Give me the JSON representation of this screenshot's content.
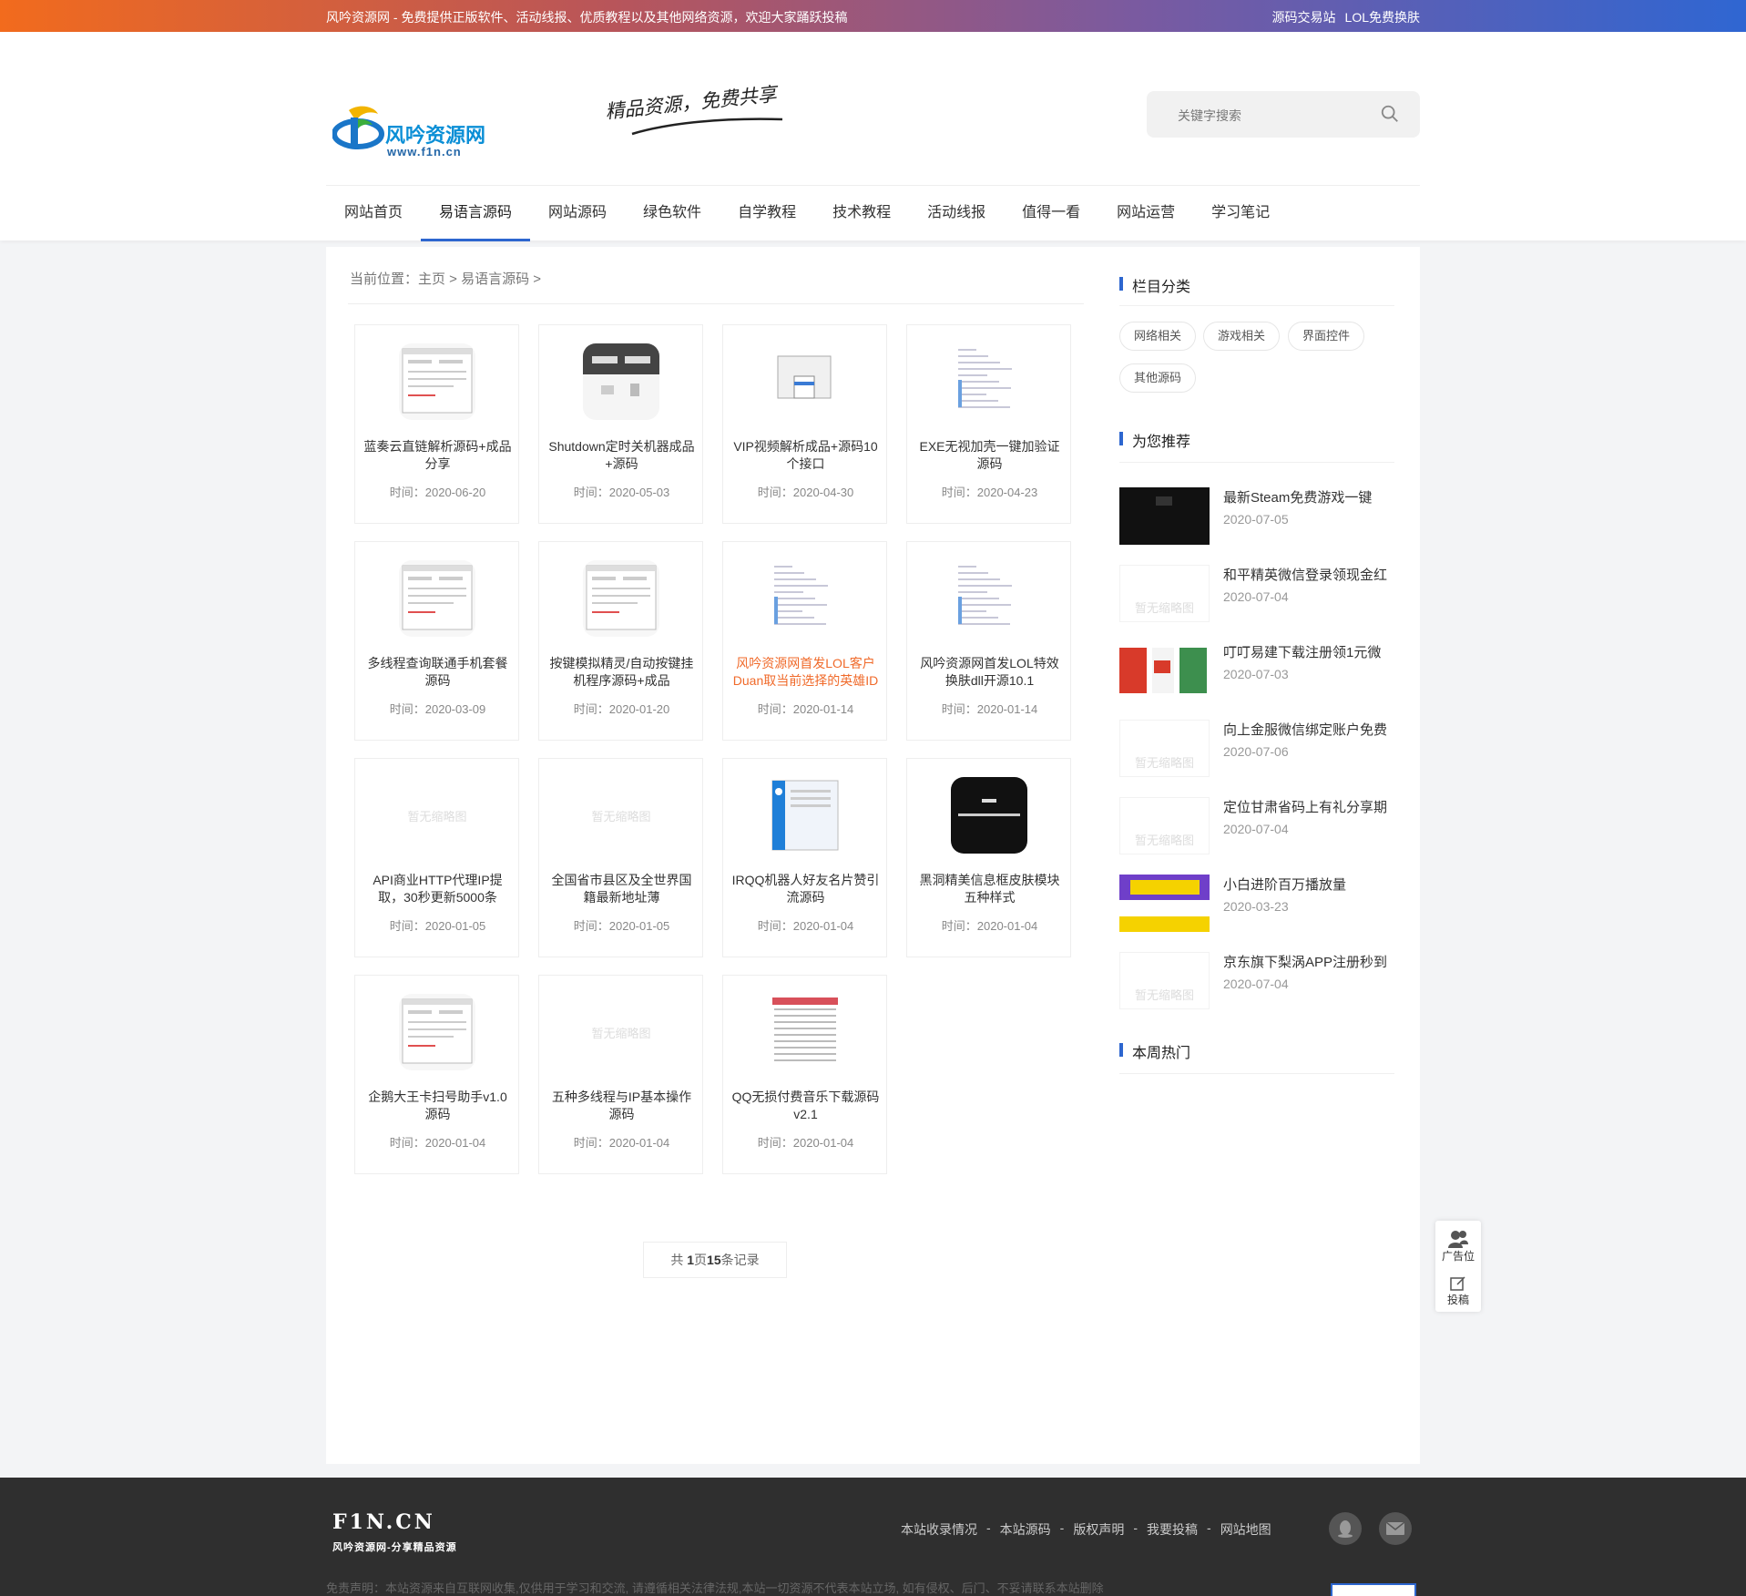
{
  "topbar": {
    "message": "风吟资源网 - 免费提供正版软件、活动线报、优质教程以及其他网络资源，欢迎大家踊跃投稿",
    "links": [
      "源码交易站",
      "LOL免费换肤"
    ]
  },
  "header": {
    "logo_text": "风吟资源网",
    "logo_url": "www.f1n.cn",
    "slogan": "精品资源，免费共享",
    "search_placeholder": "关键字搜索"
  },
  "nav": [
    {
      "label": "网站首页",
      "active": false
    },
    {
      "label": "易语言源码",
      "active": true
    },
    {
      "label": "网站源码",
      "active": false
    },
    {
      "label": "绿色软件",
      "active": false
    },
    {
      "label": "自学教程",
      "active": false
    },
    {
      "label": "技术教程",
      "active": false
    },
    {
      "label": "活动线报",
      "active": false
    },
    {
      "label": "值得一看",
      "active": false
    },
    {
      "label": "网站运营",
      "active": false
    },
    {
      "label": "学习笔记",
      "active": false
    }
  ],
  "breadcrumb": "当前位置：主页 > 易语言源码 >",
  "no_thumb_text": "暂无缩略图",
  "cards": [
    {
      "title": "蓝奏云直链解析源码+成品分享",
      "date": "时间：2020-06-20",
      "thumb": "window",
      "highlight": false
    },
    {
      "title": "Shutdown定时关机器成品+源码",
      "date": "时间：2020-05-03",
      "thumb": "dark-window",
      "highlight": false
    },
    {
      "title": "VIP视频解析成品+源码10个接口",
      "date": "时间：2020-04-30",
      "thumb": "dialog",
      "highlight": false
    },
    {
      "title": "EXE无视加壳一键加验证源码",
      "date": "时间：2020-04-23",
      "thumb": "code",
      "highlight": false
    },
    {
      "title": "多线程查询联通手机套餐源码",
      "date": "时间：2020-03-09",
      "thumb": "window",
      "highlight": false
    },
    {
      "title": "按键模拟精灵/自动按键挂机程序源码+成品",
      "date": "时间：2020-01-20",
      "thumb": "window",
      "highlight": false
    },
    {
      "title": "风吟资源网首发LOL客户Duan取当前选择的英雄ID",
      "date": "时间：2020-01-14",
      "thumb": "code",
      "highlight": true
    },
    {
      "title": "风吟资源网首发LOL特效换肤dll开源10.1",
      "date": "时间：2020-01-14",
      "thumb": "code",
      "highlight": false
    },
    {
      "title": "API商业HTTP代理IP提取，30秒更新5000条",
      "date": "时间：2020-01-05",
      "thumb": "none",
      "highlight": false
    },
    {
      "title": "全国省市县区及全世界国籍最新地址薄",
      "date": "时间：2020-01-05",
      "thumb": "none",
      "highlight": false
    },
    {
      "title": "IRQQ机器人好友名片赞引流源码",
      "date": "时间：2020-01-04",
      "thumb": "blue-window",
      "highlight": false
    },
    {
      "title": "黑洞精美信息框皮肤模块五种样式",
      "date": "时间：2020-01-04",
      "thumb": "black",
      "highlight": false
    },
    {
      "title": "企鹅大王卡扫号助手v1.0源码",
      "date": "时间：2020-01-04",
      "thumb": "window",
      "highlight": false
    },
    {
      "title": "五种多线程与IP基本操作源码",
      "date": "时间：2020-01-04",
      "thumb": "none",
      "highlight": false
    },
    {
      "title": "QQ无损付费音乐下载源码v2.1",
      "date": "时间：2020-01-04",
      "thumb": "table",
      "highlight": false
    }
  ],
  "pager": {
    "prefix": "共 ",
    "pages": "1",
    "mid": "页",
    "count": "15",
    "suffix": "条记录"
  },
  "sidebar": {
    "category_title": "栏目分类",
    "categories": [
      "网络相关",
      "游戏相关",
      "界面控件",
      "其他源码"
    ],
    "recommend_title": "为您推荐",
    "recommend": [
      {
        "title": "最新Steam免费游戏一键",
        "date": "2020-07-05",
        "thumb": "dark"
      },
      {
        "title": "和平精英微信登录领现金红",
        "date": "2020-07-04",
        "thumb": "none"
      },
      {
        "title": "叮叮易建下载注册领1元微",
        "date": "2020-07-03",
        "thumb": "promo"
      },
      {
        "title": "向上金服微信绑定账户免费",
        "date": "2020-07-06",
        "thumb": "none"
      },
      {
        "title": "定位甘肃省码上有礼分享期",
        "date": "2020-07-04",
        "thumb": "none"
      },
      {
        "title": "小白进阶百万播放量",
        "date": "2020-03-23",
        "thumb": "yellow"
      },
      {
        "title": "京东旗下梨涡APP注册秒到",
        "date": "2020-07-04",
        "thumb": "none"
      }
    ],
    "hot_title": "本周热门"
  },
  "float": {
    "ad": "广告位",
    "submit": "投稿"
  },
  "footer": {
    "logo_big": "F1N.CN",
    "logo_small": "风吟资源网-分享精品资源",
    "links": [
      "本站收录情况",
      "-",
      "本站源码",
      "-",
      "版权声明",
      "-",
      "我要投稿",
      "-",
      "网站地图"
    ],
    "disclaimer": "免责声明：本站资源来自互联网收集,仅供用于学习和交流, 请遵循相关法律法规,本站一切资源不代表本站立场, 如有侵权、后门、不妥请联系本站删除"
  },
  "colors": {
    "accent": "#2d66cf",
    "highlight": "#f06a2a",
    "footer_bg": "#2f2f2f"
  }
}
